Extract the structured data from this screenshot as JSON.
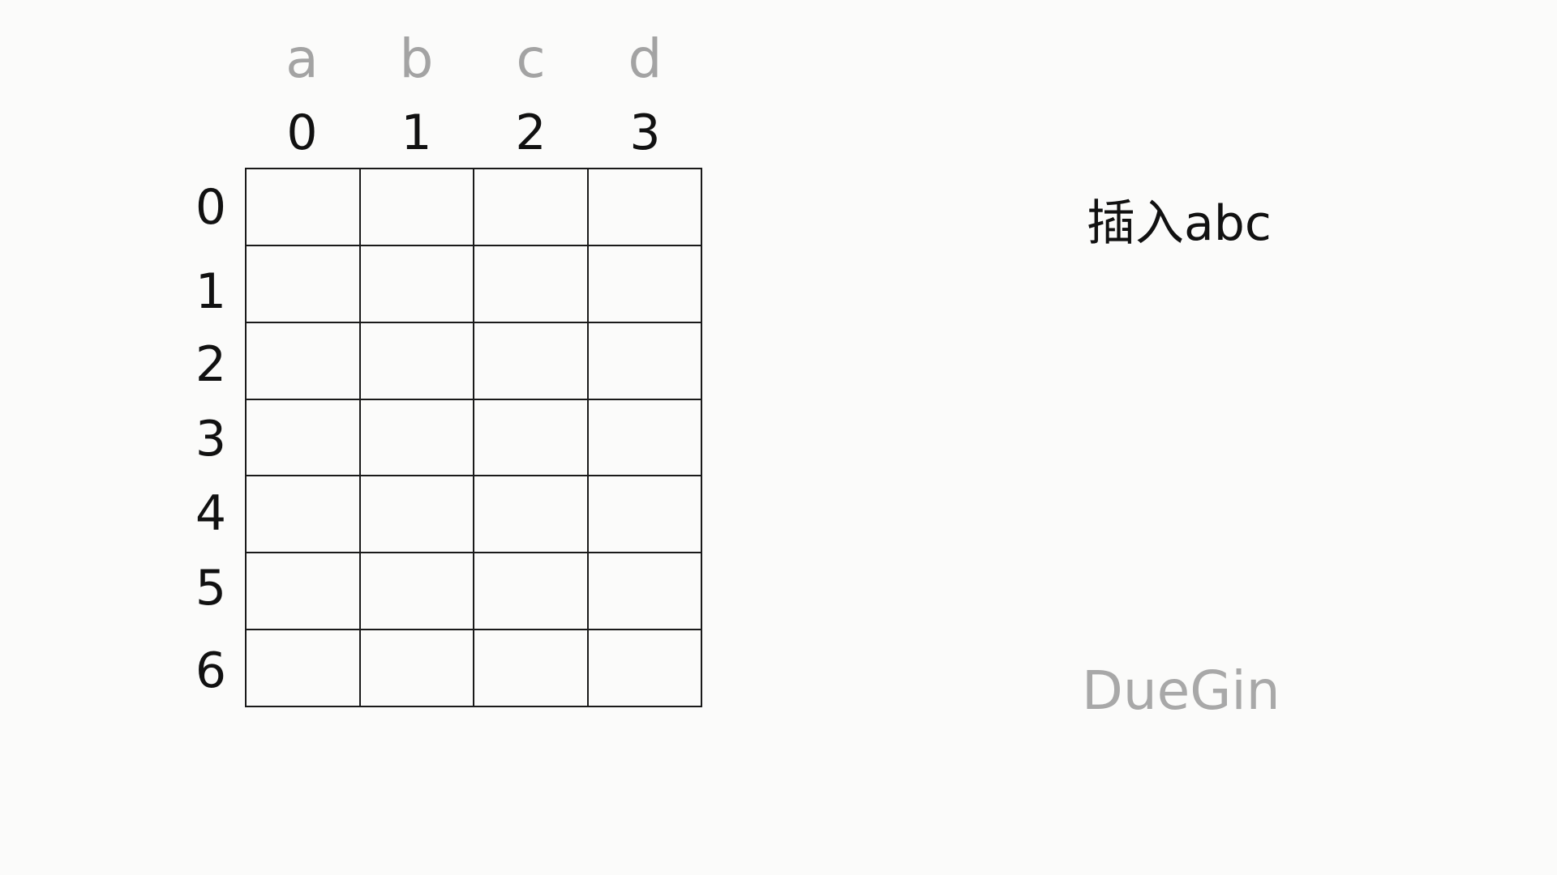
{
  "columns": {
    "letters": [
      "a",
      "b",
      "c",
      "d"
    ],
    "indices": [
      "0",
      "1",
      "2",
      "3"
    ]
  },
  "rows": {
    "indices": [
      "0",
      "1",
      "2",
      "3",
      "4",
      "5",
      "6"
    ]
  },
  "caption": "插入abc",
  "watermark": "DueGin"
}
